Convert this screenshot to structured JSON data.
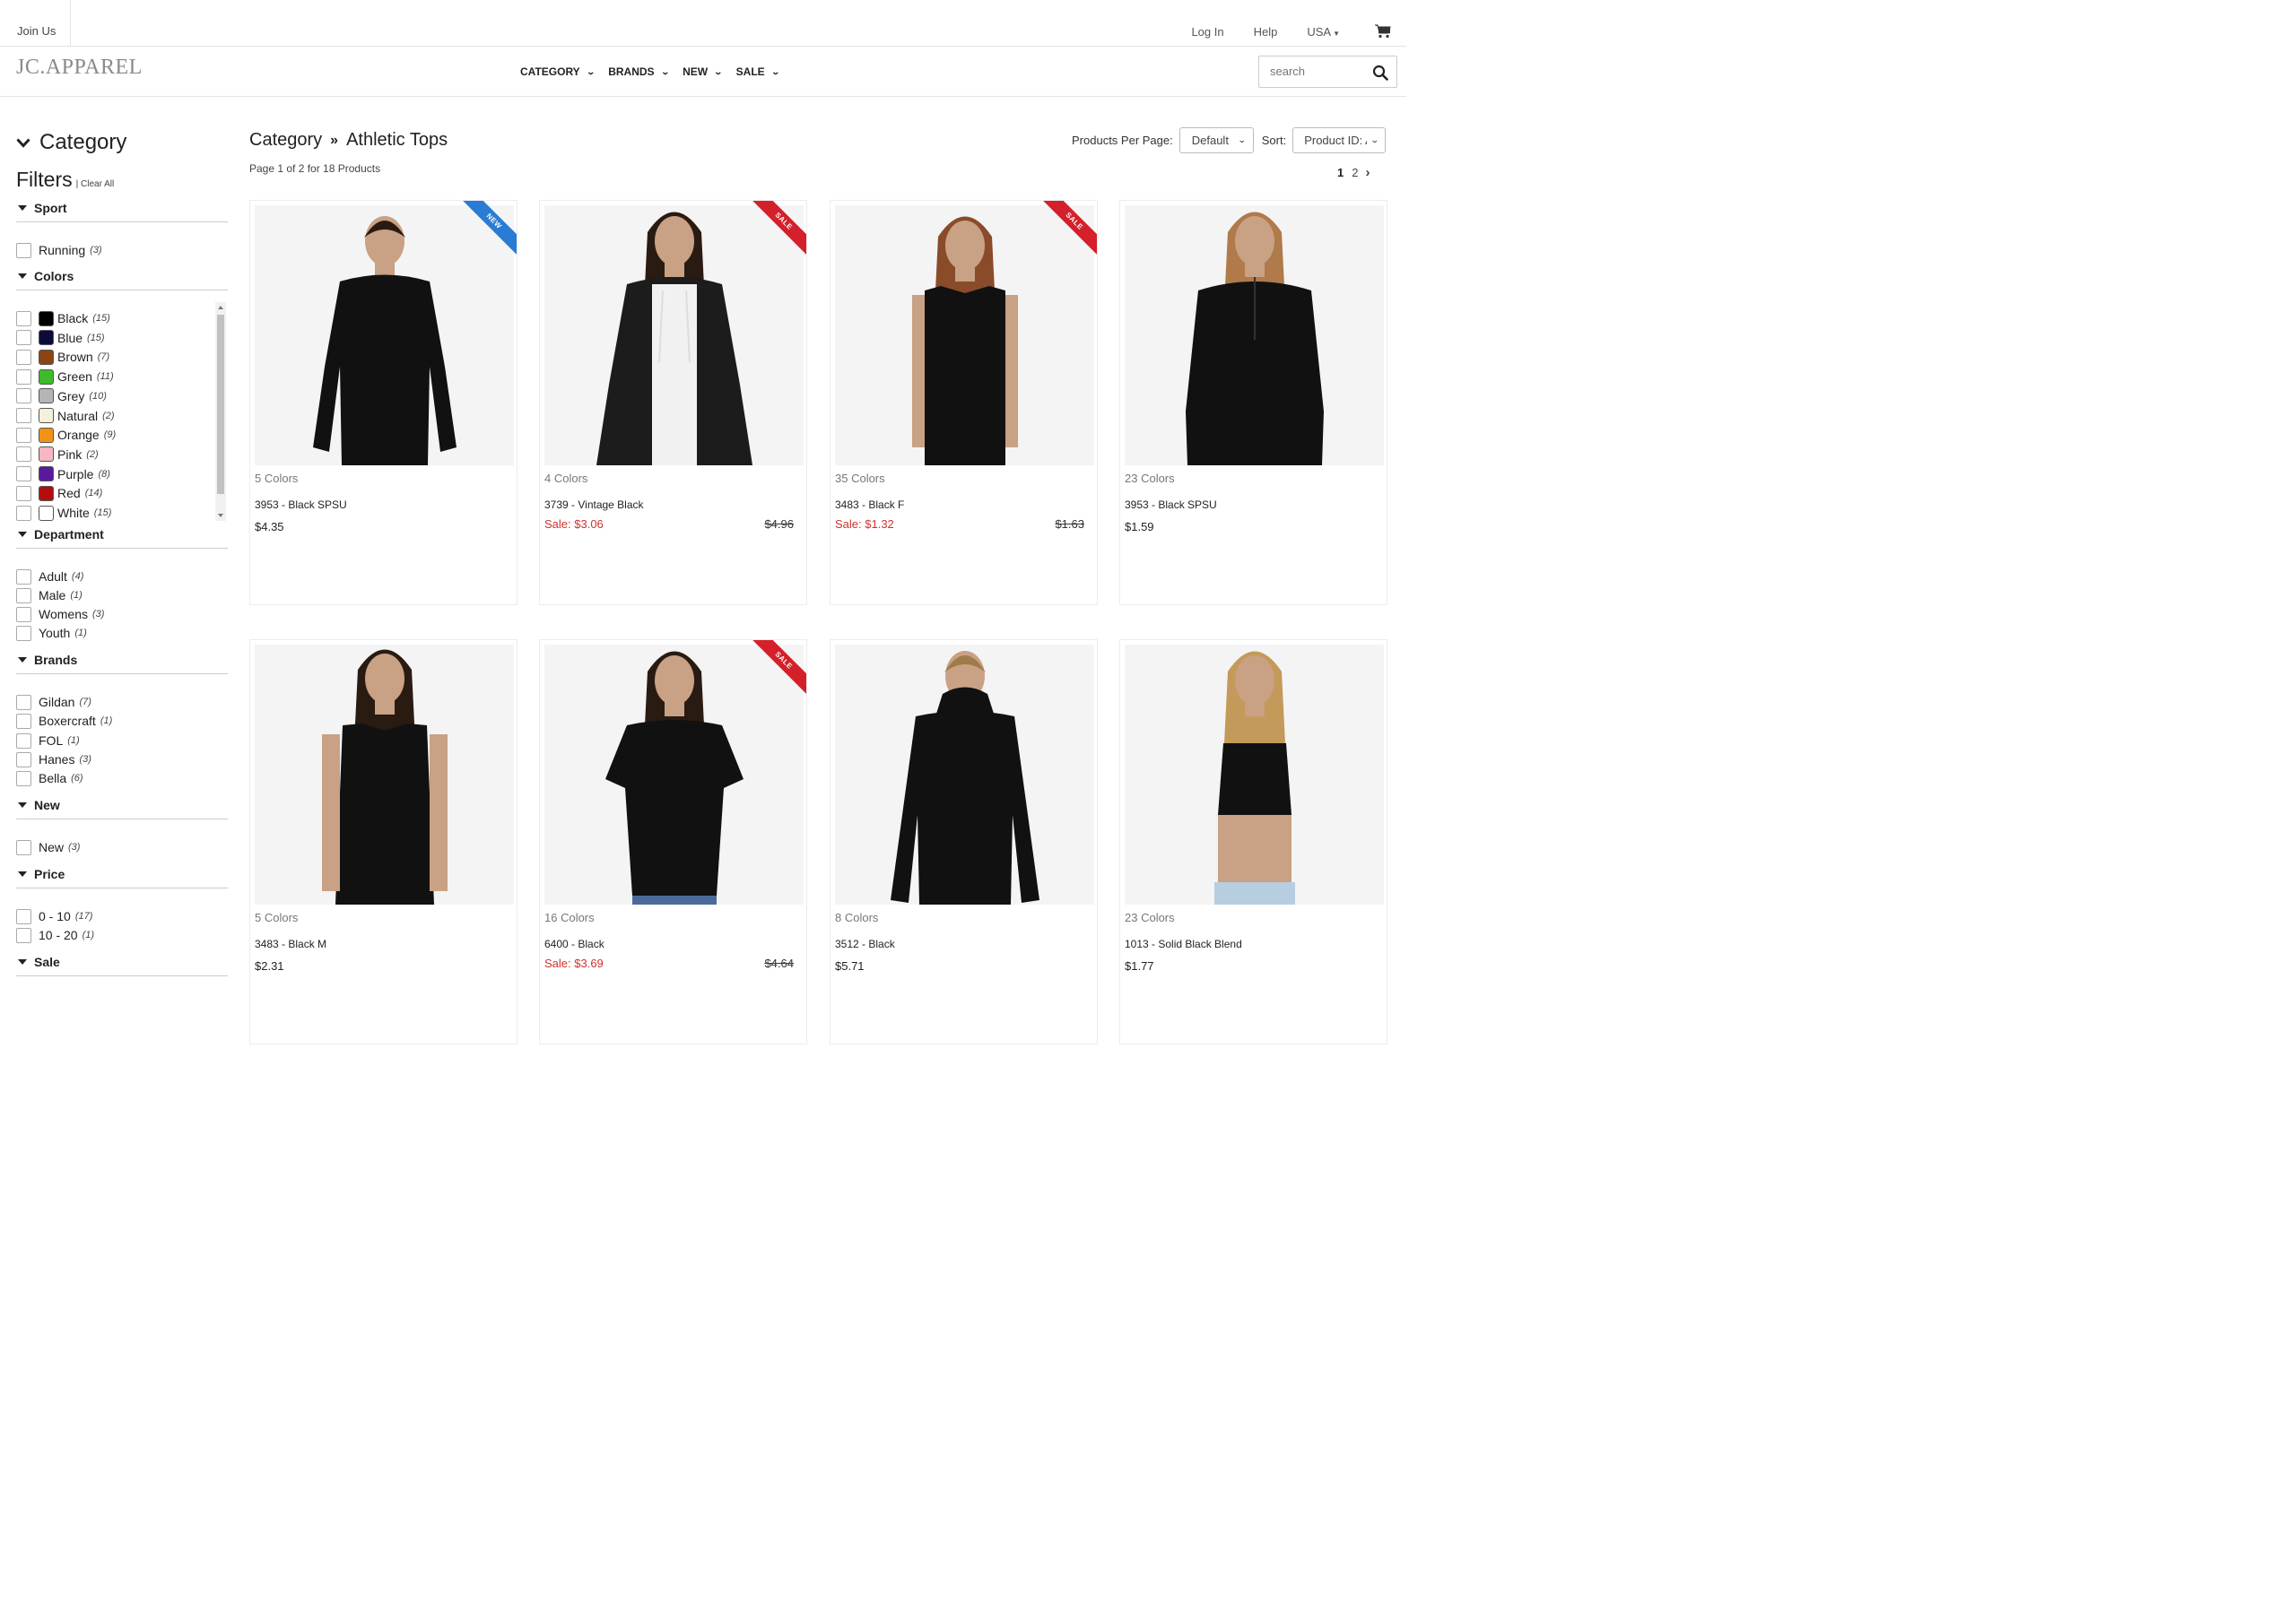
{
  "topbar": {
    "join": "Join Us",
    "login": "Log In",
    "help": "Help",
    "region": "USA"
  },
  "header": {
    "logo": "JC.APPAREL",
    "nav": [
      "CATEGORY",
      "BRANDS",
      "NEW",
      "SALE"
    ],
    "search_placeholder": "search"
  },
  "sidebar": {
    "category_title": "Category",
    "filters_title": "Filters",
    "clear_all": "Clear All",
    "sections": {
      "sport": {
        "title": "Sport",
        "options": [
          {
            "label": "Running",
            "count": "(3)"
          }
        ]
      },
      "colors": {
        "title": "Colors",
        "options": [
          {
            "label": "Black",
            "count": "(15)",
            "swatch": "#000000"
          },
          {
            "label": "Blue",
            "count": "(15)",
            "swatch": "#0b0b3b"
          },
          {
            "label": "Brown",
            "count": "(7)",
            "swatch": "#8b4513"
          },
          {
            "label": "Green",
            "count": "(11)",
            "swatch": "#3dbb2b"
          },
          {
            "label": "Grey",
            "count": "(10)",
            "swatch": "#b5b5b5"
          },
          {
            "label": "Natural",
            "count": "(2)",
            "swatch": "#f5f0dc"
          },
          {
            "label": "Orange",
            "count": "(9)",
            "swatch": "#f29316"
          },
          {
            "label": "Pink",
            "count": "(2)",
            "swatch": "#f7b6c2"
          },
          {
            "label": "Purple",
            "count": "(8)",
            "swatch": "#5a1a9e"
          },
          {
            "label": "Red",
            "count": "(14)",
            "swatch": "#b30e0e"
          },
          {
            "label": "White",
            "count": "(15)",
            "swatch": "#ffffff"
          }
        ]
      },
      "department": {
        "title": "Department",
        "options": [
          {
            "label": "Adult",
            "count": "(4)"
          },
          {
            "label": "Male",
            "count": "(1)"
          },
          {
            "label": "Womens",
            "count": "(3)"
          },
          {
            "label": "Youth",
            "count": "(1)"
          }
        ]
      },
      "brands": {
        "title": "Brands",
        "options": [
          {
            "label": "Gildan",
            "count": "(7)"
          },
          {
            "label": "Boxercraft",
            "count": "(1)"
          },
          {
            "label": "FOL",
            "count": "(1)"
          },
          {
            "label": "Hanes",
            "count": "(3)"
          },
          {
            "label": "Bella",
            "count": "(6)"
          }
        ]
      },
      "new": {
        "title": "New",
        "options": [
          {
            "label": "New",
            "count": "(3)"
          }
        ]
      },
      "price": {
        "title": "Price",
        "options": [
          {
            "label": "0 - 10",
            "count": "(17)"
          },
          {
            "label": "10 - 20",
            "count": "(1)"
          }
        ]
      },
      "sale": {
        "title": "Sale"
      }
    }
  },
  "main": {
    "breadcrumb": {
      "root": "Category",
      "current": "Athletic Tops"
    },
    "page_info": "Page 1 of 2 for 18 Products",
    "products_per_page_label": "Products Per Page:",
    "products_per_page_value": "Default",
    "sort_label": "Sort:",
    "sort_value": "Product ID: A",
    "pagination": {
      "current": "1",
      "next": "2"
    }
  },
  "products": [
    {
      "colors": "5 Colors",
      "name": "3953 - Black SPSU",
      "price": "$4.35",
      "badge": "NEW",
      "figure": "longsleeve"
    },
    {
      "colors": "4 Colors",
      "name": "3739 - Vintage Black",
      "sale": "Sale: $3.06",
      "original": "$4.96",
      "badge": "SALE",
      "figure": "hoodie"
    },
    {
      "colors": "35 Colors",
      "name": "3483 - Black F",
      "sale": "Sale: $1.32",
      "original": "$1.63",
      "badge": "SALE",
      "figure": "tank-f"
    },
    {
      "colors": "23 Colors",
      "name": "3953 - Black SPSU",
      "price": "$1.59",
      "figure": "halfzip"
    },
    {
      "colors": "5 Colors",
      "name": "3483 - Black M",
      "price": "$2.31",
      "figure": "tank-m"
    },
    {
      "colors": "16 Colors",
      "name": "6400 - Black",
      "sale": "Sale: $3.69",
      "original": "$4.64",
      "badge": "SALE",
      "figure": "tee-f"
    },
    {
      "colors": "8 Colors",
      "name": "3512 - Black",
      "price": "$5.71",
      "figure": "lshoodie"
    },
    {
      "colors": "23 Colors",
      "name": "1013 - Solid Black Blend",
      "price": "$1.77",
      "figure": "crop"
    }
  ],
  "theme": {
    "sale_red": "#d0312d",
    "ribbon_new": "#2a7bd4",
    "ribbon_sale": "#d4202a"
  }
}
